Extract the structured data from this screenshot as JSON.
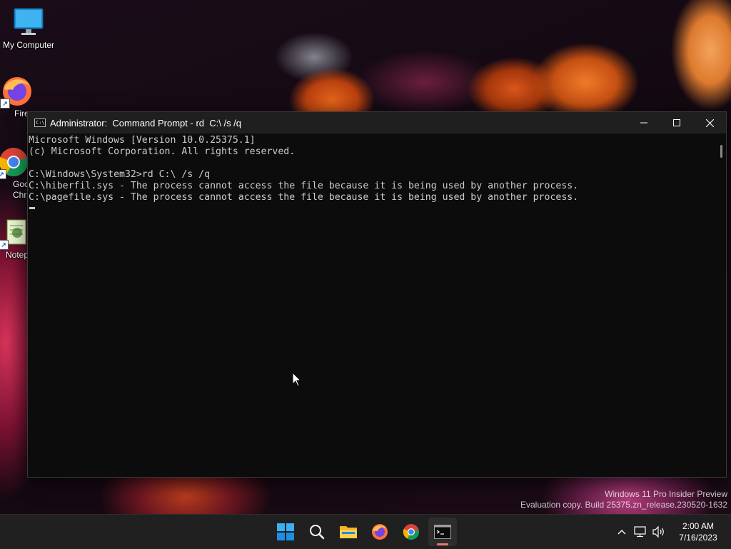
{
  "desktop": {
    "icons": [
      {
        "label": "My Computer",
        "icon": "monitor-icon"
      },
      {
        "label": "Fire",
        "icon": "firefox-icon"
      },
      {
        "label": "Goc\nChr",
        "icon": "chrome-icon"
      },
      {
        "label": "Notep",
        "icon": "notepad-icon"
      }
    ],
    "watermark": {
      "line1": "Windows 11 Pro Insider Preview",
      "line2": "Evaluation copy. Build 25375.zn_release.230520-1632"
    }
  },
  "window": {
    "title": "Administrator:  Command Prompt - rd  C:\\ /s /q",
    "icon": "cmd-icon",
    "controls": {
      "minimize": "minimize-icon",
      "maximize": "maximize-icon",
      "close": "close-icon"
    },
    "console_lines": [
      "Microsoft Windows [Version 10.0.25375.1]",
      "(c) Microsoft Corporation. All rights reserved.",
      "",
      "C:\\Windows\\System32>rd C:\\ /s /q",
      "C:\\hiberfil.sys - The process cannot access the file because it is being used by another process.",
      "C:\\pagefile.sys - The process cannot access the file because it is being used by another process."
    ]
  },
  "taskbar": {
    "apps": [
      {
        "name": "start",
        "icon": "windows-logo-icon"
      },
      {
        "name": "search",
        "icon": "search-icon"
      },
      {
        "name": "file-explorer",
        "icon": "folder-icon"
      },
      {
        "name": "firefox",
        "icon": "firefox-icon"
      },
      {
        "name": "chrome",
        "icon": "chrome-icon"
      },
      {
        "name": "terminal",
        "icon": "terminal-icon",
        "active": true
      }
    ],
    "tray": {
      "icons": [
        "chevron-up-icon",
        "network-icon",
        "speaker-icon"
      ],
      "time": "2:00 AM",
      "date": "7/16/2023"
    }
  },
  "colors": {
    "console_bg": "#0c0c0c",
    "console_text": "#cccccc",
    "titlebar_bg": "#1f1f1f",
    "taskbar_bg": "#202020",
    "active_indicator": "#e07a6e"
  }
}
